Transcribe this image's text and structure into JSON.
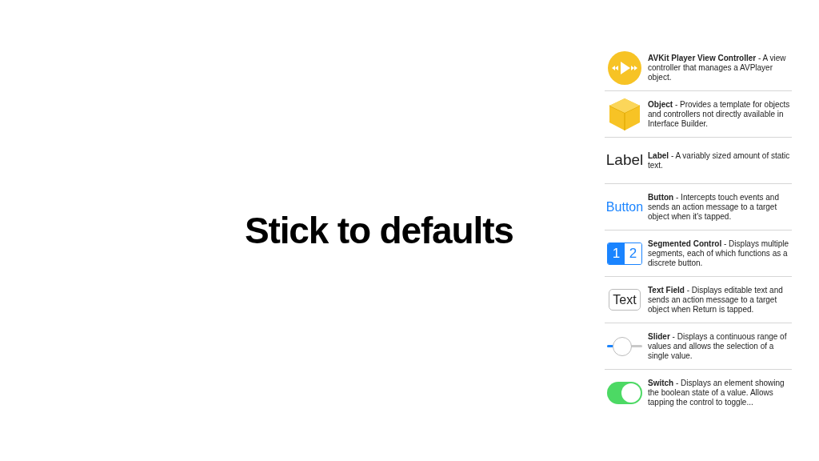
{
  "title": "Stick to defaults",
  "library": [
    {
      "kind": "player",
      "description": "**AVKit Player View Controller** - A view controller that manages a AVPlayer object."
    },
    {
      "kind": "object",
      "description": "**Object** - Provides a template for objects and controllers not directly available in Interface Builder."
    },
    {
      "kind": "label",
      "preview": "Label",
      "description": "**Label** - A variably sized amount of static text."
    },
    {
      "kind": "button",
      "preview": "Button",
      "description": "**Button** - Intercepts touch events and sends an action message to a target object when it's tapped."
    },
    {
      "kind": "segmented",
      "segments": [
        {
          "label": "1",
          "selected": true
        },
        {
          "label": "2",
          "selected": false
        }
      ],
      "description": "**Segmented Control** - Displays multiple segments, each of which functions as a discrete button."
    },
    {
      "kind": "textfield",
      "preview": "Text",
      "description": "**Text Field** - Displays editable text and sends an action message to a target object when Return is tapped."
    },
    {
      "kind": "slider",
      "level": 0.2,
      "description": "**Slider** - Displays a continuous range of values and allows the selection of a single value."
    },
    {
      "kind": "switch",
      "on": true,
      "description": "**Switch** - Displays an element showing the boolean state of a value. Allows tapping the control to toggle..."
    }
  ]
}
